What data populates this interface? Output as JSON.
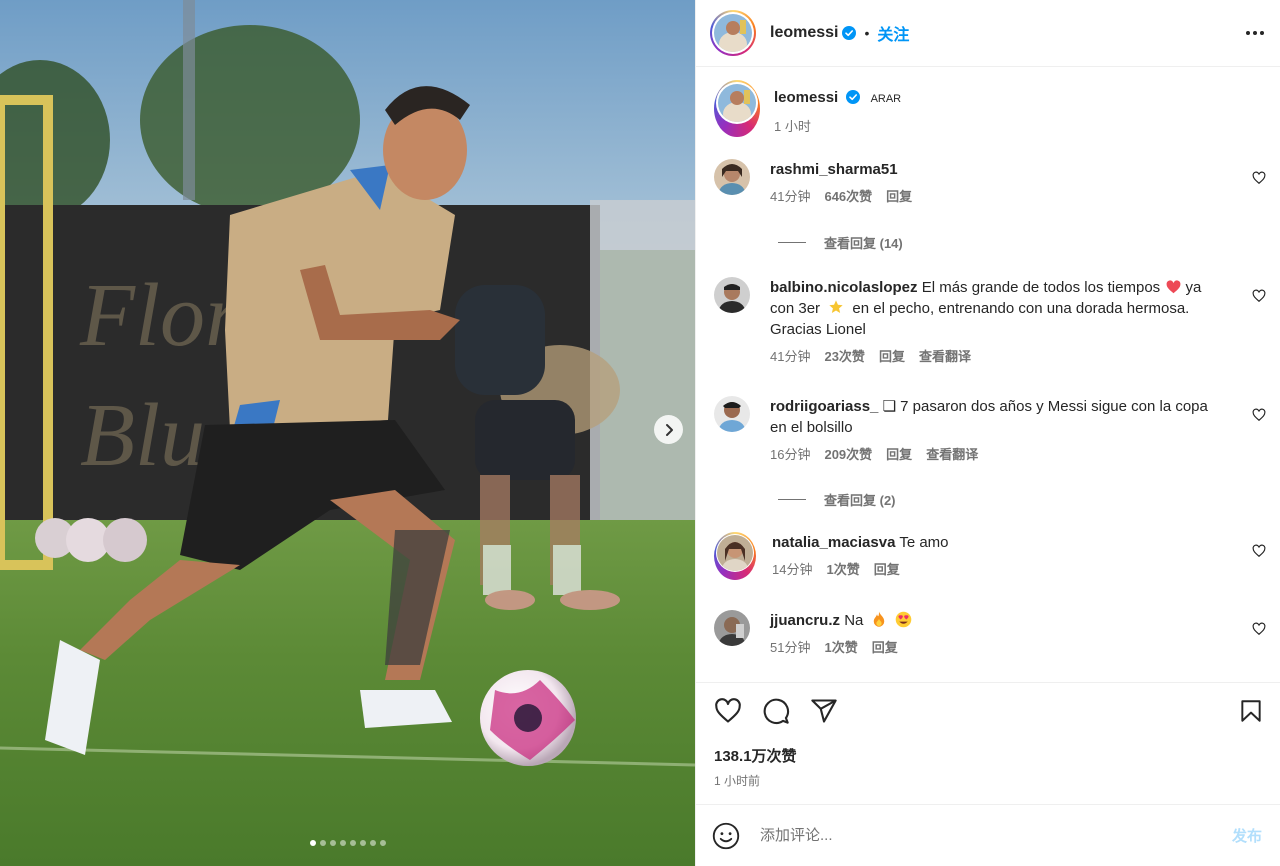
{
  "post": {
    "username": "leomessi",
    "follow_label": "关注",
    "separator": "•",
    "carousel_total": 8,
    "carousel_active": 1
  },
  "caption": {
    "username": "leomessi",
    "text": "ARAR",
    "time": "1 小时"
  },
  "comments": [
    {
      "username": "rashmi_sharma51",
      "text": "",
      "time": "41分钟",
      "likes": "646次赞",
      "reply": "回复",
      "translate": "",
      "view_replies": "查看回复 (14)"
    },
    {
      "username": "balbino.nicolaslopez",
      "text_1": "El más grande de todos los tiempos",
      "text_2": "ya con 3er",
      "text_3": "en el pecho, entrenando con una dorada",
      "text_4": "hermosa. Gracias Lionel",
      "time": "41分钟",
      "likes": "23次赞",
      "reply": "回复",
      "translate": "查看翻译"
    },
    {
      "username": "rodriigoariass_",
      "text_1": "❏ 7 pasaron dos años y Messi sigue con la",
      "text_2": "copa en el bolsillo",
      "time": "16分钟",
      "likes": "209次赞",
      "reply": "回复",
      "translate": "查看翻译",
      "view_replies": "查看回复 (2)"
    },
    {
      "username": "natalia_maciasva",
      "text": "Te amo",
      "time": "14分钟",
      "likes": "1次赞",
      "reply": "回复"
    },
    {
      "username": "jjuancru.z",
      "text": "Na",
      "time": "51分钟",
      "likes": "1次赞",
      "reply": "回复"
    }
  ],
  "stats": {
    "likes": "138.1万次赞",
    "ago": "1 小时前"
  },
  "composer": {
    "placeholder": "添加评论...",
    "post_label": "发布"
  },
  "colors": {
    "accent": "#0095f6",
    "post_disabled": "#b2dffc",
    "verified": "#0095f6",
    "red_heart": "#ed4956"
  },
  "icons": {
    "like": "heart-icon",
    "comment": "comment-icon",
    "share": "send-icon",
    "save": "bookmark-icon",
    "emoji": "emoji-icon",
    "more": "more-icon",
    "next": "chevron-right-icon"
  }
}
